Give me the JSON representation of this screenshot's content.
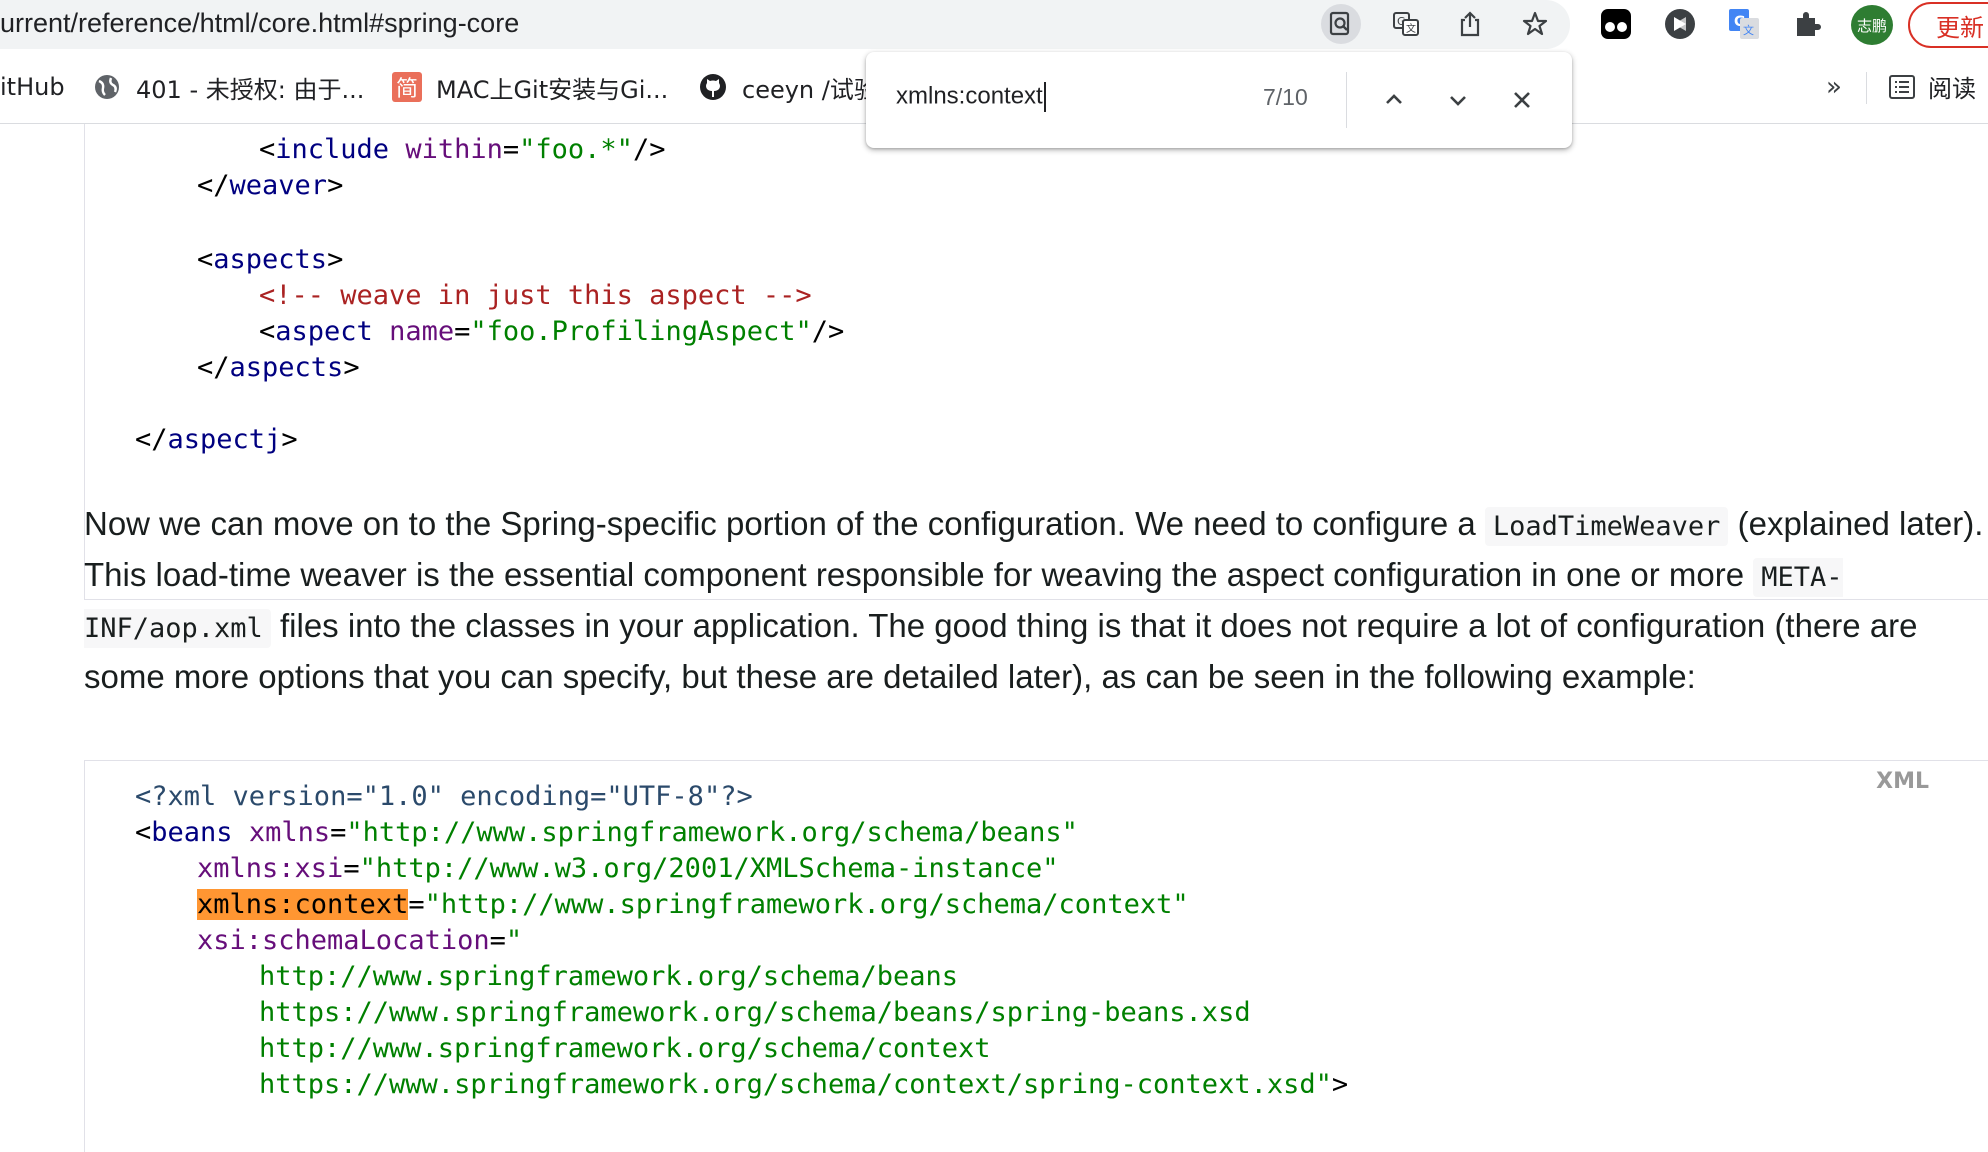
{
  "browser": {
    "url": "urrent/reference/html/core.html#spring-core",
    "update_label": "更新",
    "avatar_text": "志鹏",
    "colors": {
      "accent": "#d93025",
      "avatar": "#2e7d32",
      "find_highlight": "#ff9632"
    }
  },
  "bookmarks": {
    "items": [
      {
        "label": "itHub",
        "icon": "github-icon"
      },
      {
        "label": "401 - 未授权: 由于...",
        "icon": "globe-icon"
      },
      {
        "label": "MAC上Git安装与Gi...",
        "icon": "jianshu-icon",
        "icon_text": "简"
      },
      {
        "label": "ceeyn /试验",
        "icon": "github-icon"
      }
    ],
    "more": "»",
    "reading_list": "阅读"
  },
  "find": {
    "query": "xmlns:context",
    "count": "7/10"
  },
  "code_top": {
    "include_tag": "include",
    "within_attr": "within",
    "within_val": "\"foo.*\"",
    "weaver_tag": "weaver",
    "aspects_tag": "aspects",
    "comment": "<!-- weave in just this aspect -->",
    "aspect_tag": "aspect",
    "name_attr": "name",
    "name_val": "\"foo.ProfilingAspect\"",
    "aspectj_tag": "aspectj"
  },
  "paragraph": {
    "p1": "Now we can move on to the Spring-specific portion of the configuration. We need to configure a ",
    "code1": "LoadTimeWeaver",
    "p2": " (explained later). This load-time weaver is the essential component responsible for weaving the aspect configuration in one or more ",
    "code2": "META-INF/aop.xml",
    "p3": " files into the classes in your application. The good thing is that it does not require a lot of configuration (there are some more options that you can specify, but these are detailed later), as can be seen in the following example:"
  },
  "code_bottom": {
    "lang": "XML",
    "xml_decl": "<?xml version=\"1.0\" encoding=\"UTF-8\"?>",
    "beans_tag": "beans",
    "xmlns_attr": "xmlns",
    "xmlns_val": "\"http://www.springframework.org/schema/beans\"",
    "xsi_attr": "xmlns:xsi",
    "xsi_val": "\"http://www.w3.org/2001/XMLSchema-instance\"",
    "context_attr": "xmlns:context",
    "context_val": "\"http://www.springframework.org/schema/context\"",
    "schema_attr": "xsi:schemaLocation",
    "schema_open": "\"",
    "loc1": "http://www.springframework.org/schema/beans",
    "loc2": "https://www.springframework.org/schema/beans/spring-beans.xsd",
    "loc3": "http://www.springframework.org/schema/context",
    "loc4": "https://www.springframework.org/schema/context/spring-context.xsd",
    "loc4_close": "\""
  }
}
